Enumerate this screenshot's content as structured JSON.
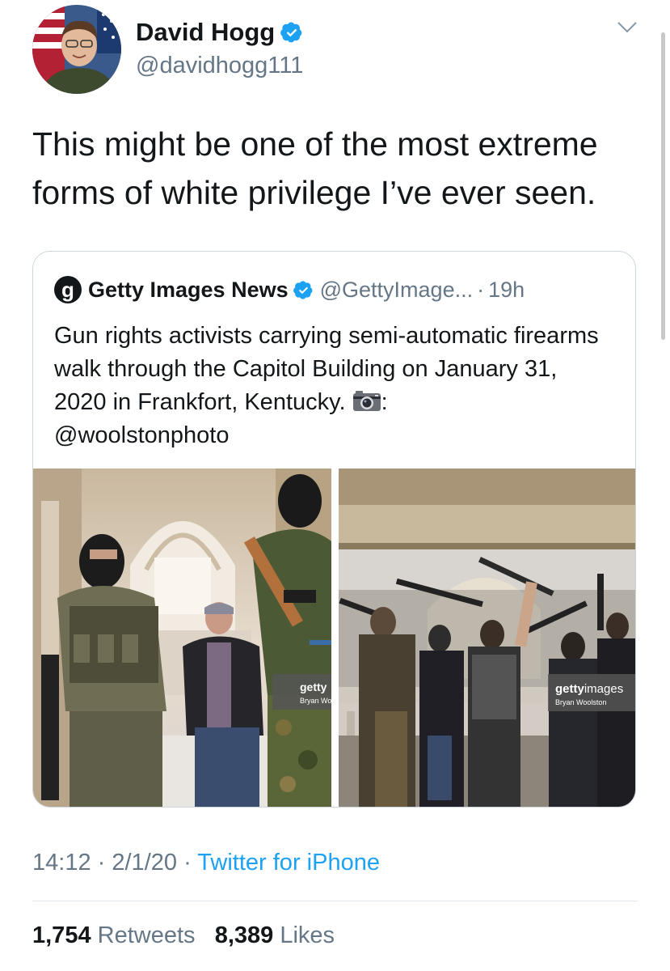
{
  "author": {
    "name": "David Hogg",
    "handle": "@davidhogg111"
  },
  "tweet": {
    "text": "This might be one of the most extreme forms of white privilege I’ve ever seen."
  },
  "quoted": {
    "logo_letter": "g",
    "name": "Getty Images News",
    "handle": "@GettyImage...",
    "separator": "·",
    "time": "19h",
    "text": "Gun rights activists carrying semi-automatic firearms walk through the Capitol Building on January 31, 2020 in Frankfort, Kentucky.",
    "text_suffix": ":",
    "credit": "@woolstonphoto",
    "photos": [
      {
        "watermark": "getty",
        "watermark_sub": "Bryan Wo"
      },
      {
        "watermark_bold": "getty",
        "watermark_rest": "images",
        "watermark_sub": "Bryan Woolston"
      }
    ]
  },
  "meta": {
    "time": "14:12",
    "sep1": "·",
    "date": "2/1/20",
    "sep2": "·",
    "client": "Twitter for iPhone"
  },
  "stats": {
    "retweets_count": "1,754",
    "retweets_label": "Retweets",
    "likes_count": "8,389",
    "likes_label": "Likes"
  },
  "colors": {
    "verified": "#1da1f2",
    "link": "#1da1f2",
    "secondary_text": "#657786"
  },
  "icons": [
    "verified-badge-icon",
    "chevron-down-icon",
    "camera-icon",
    "getty-logo-icon"
  ]
}
